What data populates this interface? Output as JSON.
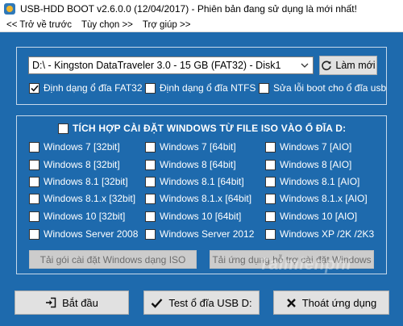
{
  "window": {
    "title": "USB-HDD BOOT v2.6.0.0 (12/04/2017) - Phiên bản đang sử dụng là mới nhất!"
  },
  "menu": [
    {
      "label": "<< Trở về trước"
    },
    {
      "label": "Tùy chọn >>"
    },
    {
      "label": "Trợ giúp >>"
    }
  ],
  "drive": {
    "selected": "D:\\ - Kingston DataTraveler 3.0 - 15 GB (FAT32) - Disk1",
    "refresh_label": "Làm mới"
  },
  "format_options": [
    {
      "label": "Định dạng ổ đĩa FAT32",
      "checked": true
    },
    {
      "label": "Định dạng ổ đĩa NTFS",
      "checked": false
    },
    {
      "label": "Sửa lỗi boot cho ổ đĩa usb",
      "checked": false
    }
  ],
  "integrate": {
    "label": "TÍCH HỢP CÀI ĐẶT WINDOWS TỪ FILE ISO VÀO Ổ ĐĨA D:",
    "checked": false
  },
  "windows_versions": [
    [
      "Windows 7 [32bit]",
      "Windows 7 [64bit]",
      "Windows 7 [AIO]"
    ],
    [
      "Windows 8 [32bit]",
      "Windows 8 [64bit]",
      "Windows 8 [AIO]"
    ],
    [
      "Windows 8.1 [32bit]",
      "Windows 8.1 [64bit]",
      "Windows 8.1 [AIO]"
    ],
    [
      "Windows 8.1.x [32bit]",
      "Windows 8.1.x [64bit]",
      "Windows 8.1.x [AIO]"
    ],
    [
      "Windows 10 [32bit]",
      "Windows 10 [64bit]",
      "Windows 10 [AIO]"
    ],
    [
      "Windows Server 2008",
      "Windows Server 2012",
      "Windows XP /2K /2K3"
    ]
  ],
  "actions": {
    "install_iso": "Tải gói cài đặt Windows dạng ISO",
    "install_support": "Tải ứng dụng hỗ trợ cài đặt Windows",
    "start": "Bắt đầu",
    "test": "Test ổ đĩa USB D:",
    "exit": "Thoát ứng dụng"
  },
  "watermark": "Taimienphi",
  "colors": {
    "background": "#1e6aad",
    "button": "#e1e1e1"
  }
}
